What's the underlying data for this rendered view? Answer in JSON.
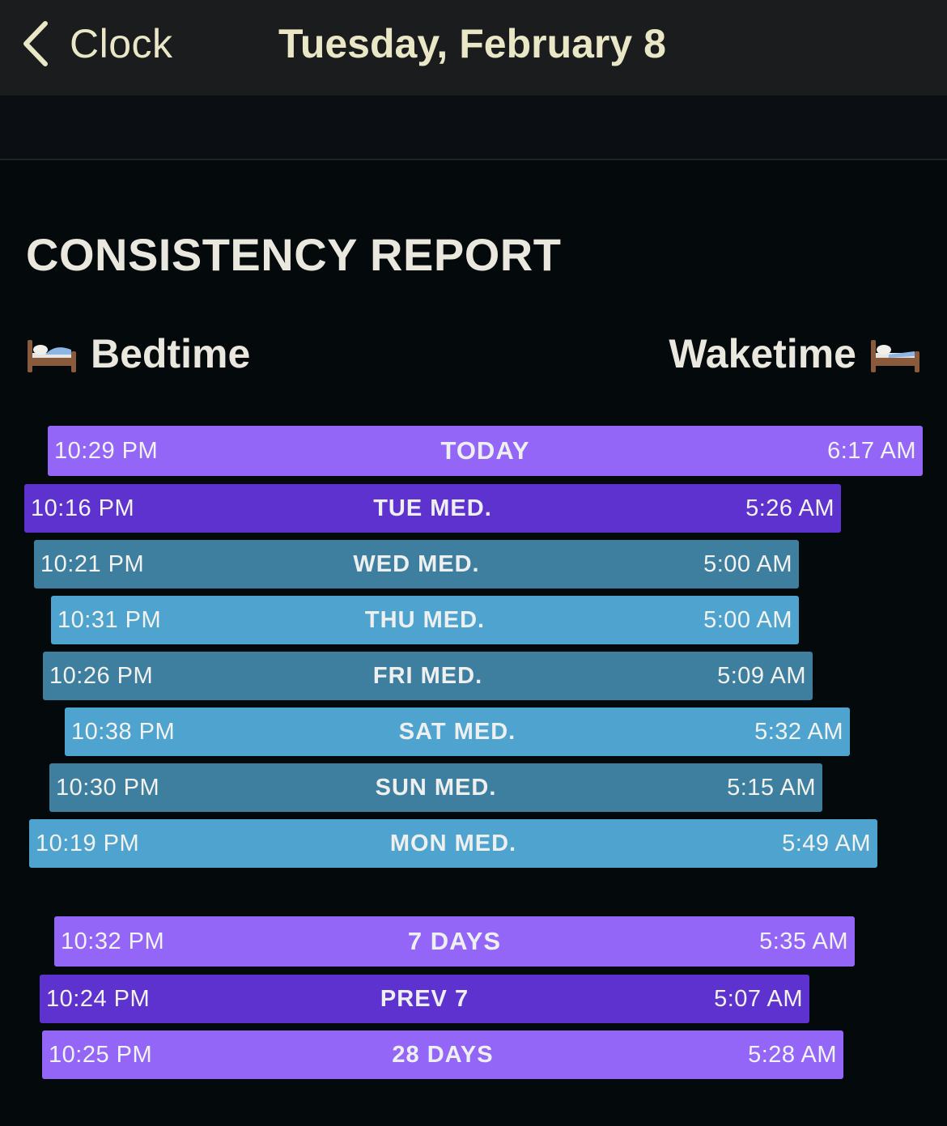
{
  "nav": {
    "back_label": "Clock",
    "title": "Tuesday, February 8"
  },
  "report": {
    "title": "CONSISTENCY REPORT",
    "bedtime_label": "Bedtime",
    "waketime_label": "Waketime",
    "icon": "bed-icon"
  },
  "colors": {
    "background": "#04090c",
    "light_purple": "#9366f7",
    "dark_purple": "#5e32ce",
    "steel_blue": "#3e7fa0",
    "sky_blue": "#4fa3cf"
  },
  "rows": [
    {
      "bedtime": "10:29 PM",
      "label": "TODAY",
      "waketime": "6:17 AM"
    },
    {
      "bedtime": "10:16 PM",
      "label": "TUE MED.",
      "waketime": "5:26 AM"
    },
    {
      "bedtime": "10:21 PM",
      "label": "WED MED.",
      "waketime": "5:00 AM"
    },
    {
      "bedtime": "10:31 PM",
      "label": "THU MED.",
      "waketime": "5:00 AM"
    },
    {
      "bedtime": "10:26 PM",
      "label": "FRI MED.",
      "waketime": "5:09 AM"
    },
    {
      "bedtime": "10:38 PM",
      "label": "SAT MED.",
      "waketime": "5:32 AM"
    },
    {
      "bedtime": "10:30 PM",
      "label": "SUN MED.",
      "waketime": "5:15 AM"
    },
    {
      "bedtime": "10:19 PM",
      "label": "MON MED.",
      "waketime": "5:49 AM"
    }
  ],
  "summary": [
    {
      "bedtime": "10:32 PM",
      "label": "7 DAYS",
      "waketime": "5:35 AM"
    },
    {
      "bedtime": "10:24 PM",
      "label": "PREV 7",
      "waketime": "5:07 AM"
    },
    {
      "bedtime": "10:25 PM",
      "label": "28 DAYS",
      "waketime": "5:28 AM"
    }
  ]
}
